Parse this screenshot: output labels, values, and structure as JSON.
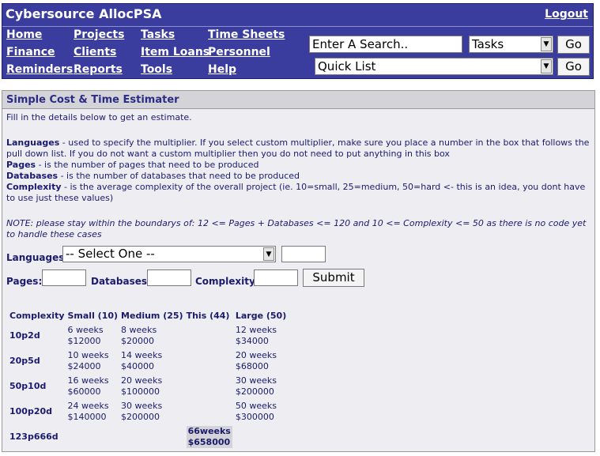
{
  "header": {
    "title": "Cybersource AllocPSA",
    "logout": "Logout",
    "nav": [
      [
        "Home",
        "Projects",
        "Tasks",
        "Time Sheets"
      ],
      [
        "Finance",
        "Clients",
        "Item Loans",
        "Personnel"
      ],
      [
        "Reminders",
        "Reports",
        "Tools",
        "Help"
      ]
    ],
    "search_value": "Enter A Search..",
    "search_category": "Tasks",
    "go1": "Go",
    "quick_list": "Quick List",
    "go2": "Go"
  },
  "panel": {
    "title": "Simple Cost & Time Estimater",
    "intro": "Fill in the details below to get an estimate.",
    "help": [
      {
        "term": "Languages",
        "text": " - used to specify the multiplier. If you select custom multiplier, make sure you place a number in the box that follows the pull down list. If you do not want a custom multiplier then you do not need to put anything in this box"
      },
      {
        "term": "Pages",
        "text": " - is the number of pages that need to be produced"
      },
      {
        "term": "Databases",
        "text": " - is the number of databases that need to be produced"
      },
      {
        "term": "Complexity",
        "text": " - is the average complexity of the overall project (ie. 10=small, 25=medium, 50=hard <- this is an idea, you dont have to use just these values)"
      }
    ],
    "note": "NOTE: please stay within the boundarys of: 12 <= Pages + Databases <= 120 and 10 <= Complexity <= 50 as there is no code yet to handle these cases",
    "form": {
      "languages_label": "Languages:",
      "languages_value": "-- Select One --",
      "pages_label": "Pages:",
      "databases_label": "Databases:",
      "complexity_label": "Complexity:",
      "submit": "Submit"
    },
    "table": {
      "headers": [
        "Complexity",
        "Small (10)",
        "Medium (25)",
        "This (44)",
        "Large (50)"
      ],
      "rows": [
        {
          "name": "10p2d",
          "small": [
            "6 weeks",
            "$12000"
          ],
          "medium": [
            "8 weeks",
            "$20000"
          ],
          "this": [
            "",
            ""
          ],
          "large": [
            "12 weeks",
            "$34000"
          ]
        },
        {
          "name": "20p5d",
          "small": [
            "10 weeks",
            "$24000"
          ],
          "medium": [
            "14 weeks",
            "$40000"
          ],
          "this": [
            "",
            ""
          ],
          "large": [
            "20 weeks",
            "$68000"
          ]
        },
        {
          "name": "50p10d",
          "small": [
            "16 weeks",
            "$60000"
          ],
          "medium": [
            "20 weeks",
            "$100000"
          ],
          "this": [
            "",
            ""
          ],
          "large": [
            "30 weeks",
            "$200000"
          ]
        },
        {
          "name": "100p20d",
          "small": [
            "24 weeks",
            "$140000"
          ],
          "medium": [
            "30 weeks",
            "$200000"
          ],
          "this": [
            "",
            ""
          ],
          "large": [
            "50 weeks",
            "$300000"
          ]
        },
        {
          "name": "123p666d",
          "small": [
            "",
            ""
          ],
          "medium": [
            "",
            ""
          ],
          "this": [
            "66weeks",
            "$658000"
          ],
          "large": [
            "",
            ""
          ]
        }
      ]
    }
  }
}
